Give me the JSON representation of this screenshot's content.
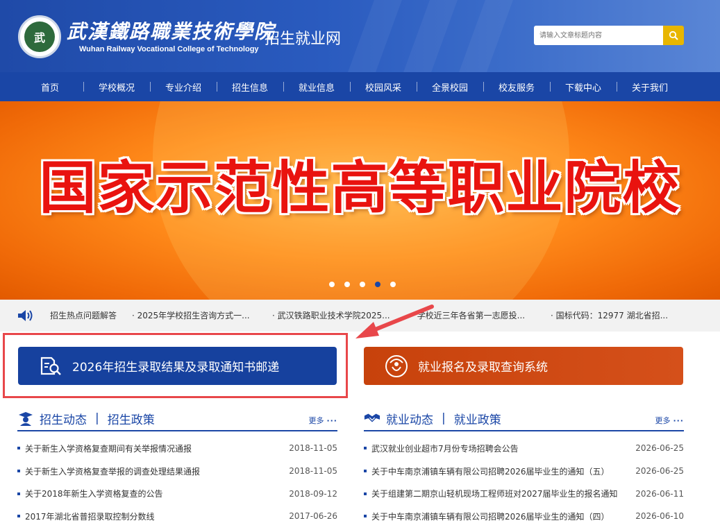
{
  "header": {
    "logo_text": "武",
    "school_name_cn": "武漢鐵路職業技術學院",
    "school_name_en": "Wuhan Railway Vocational College of Technology",
    "site_name": "招生就业网",
    "search_placeholder": "请输入文章标题内容"
  },
  "nav": [
    "首页",
    "学校概况",
    "专业介绍",
    "招生信息",
    "就业信息",
    "校园风采",
    "全景校园",
    "校友服务",
    "下载中心",
    "关于我们"
  ],
  "banner": {
    "title": "国家示范性高等职业院校",
    "dot_count": 5,
    "active_dot": 4
  },
  "ticker": [
    "招生热点问题解答",
    "· 2025年学校招生咨询方式一...",
    "· 武汉铁路职业技术学院2025...",
    "· 学校近三年各省第一志愿投...",
    "· 国标代码：12977 湖北省招..."
  ],
  "buttons": {
    "admission_result": "2026年招生录取结果及录取通知书邮递",
    "employment_system": "就业报名及录取查询系统"
  },
  "admission": {
    "tab1": "招生动态",
    "tab2": "招生政策",
    "more": "更多",
    "items": [
      {
        "title": "关于新生入学资格复查期间有关举报情况通报",
        "date": "2018-11-05"
      },
      {
        "title": "关于新生入学资格复查举报的调查处理结果通报",
        "date": "2018-11-05"
      },
      {
        "title": "关于2018年新生入学资格复查的公告",
        "date": "2018-09-12"
      },
      {
        "title": "2017年湖北省普招录取控制分数线",
        "date": "2017-06-26"
      }
    ]
  },
  "employment": {
    "tab1": "就业动态",
    "tab2": "就业政策",
    "more": "更多",
    "items": [
      {
        "title": "武汉就业创业超市7月份专场招聘会公告",
        "date": "2026-06-25"
      },
      {
        "title": "关于中车南京浦镇车辆有限公司招聘2026届毕业生的通知（五）",
        "date": "2026-06-25"
      },
      {
        "title": "关于组建第二期京山轻机现场工程师班对2027届毕业生的报名通知",
        "date": "2026-06-11"
      },
      {
        "title": "关于中车南京浦镇车辆有限公司招聘2026届毕业生的通知（四）",
        "date": "2026-06-10"
      }
    ]
  },
  "colors": {
    "primary_blue": "#1a46a6",
    "accent_orange": "#d04a14",
    "highlight_red": "#e8474a",
    "search_yellow": "#e8b600"
  }
}
